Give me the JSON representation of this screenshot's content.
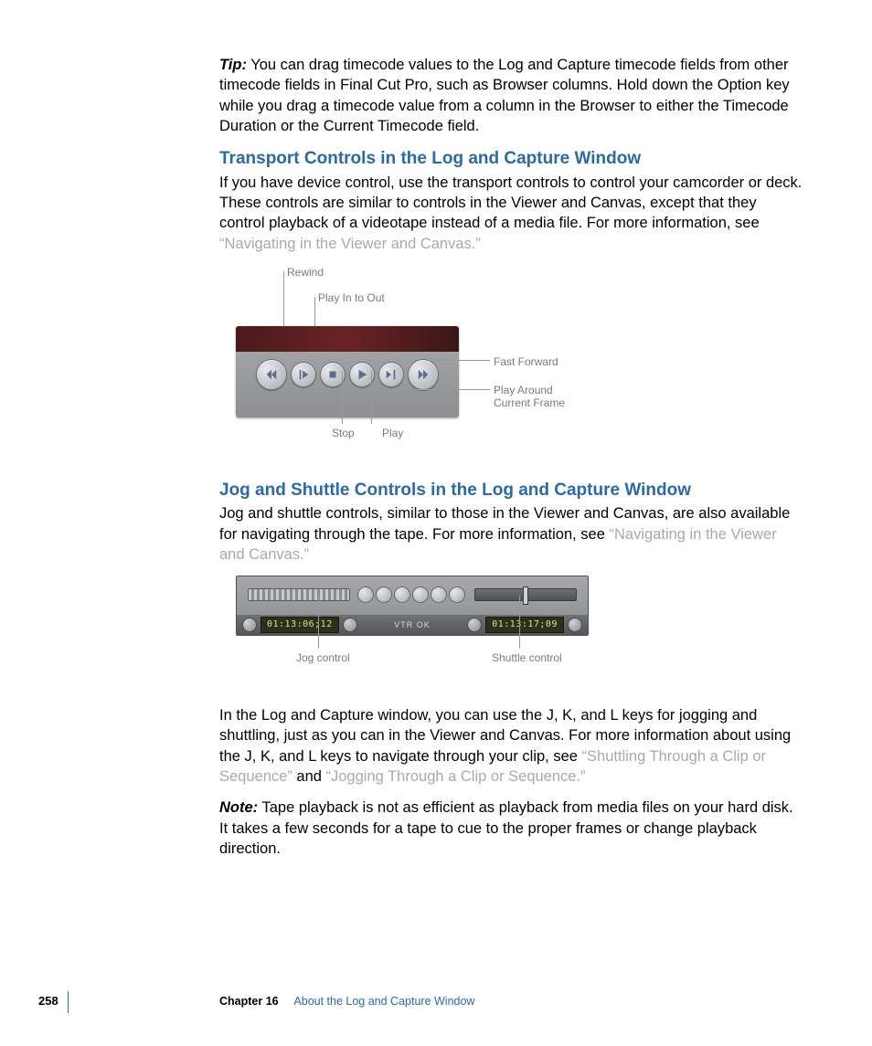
{
  "tip": {
    "label": "Tip:",
    "text": "You can drag timecode values to the Log and Capture timecode fields from other timecode fields in Final Cut Pro, such as Browser columns. Hold down the Option key while you drag a timecode value from a column in the Browser to either the Timecode Duration or the Current Timecode field."
  },
  "section1": {
    "heading": "Transport Controls in the Log and Capture Window",
    "body": "If you have device control, use the transport controls to control your camcorder or deck. These controls are similar to controls in the Viewer and Canvas, except that they control playback of a videotape instead of a media file. For more information, see ",
    "link": "“Navigating in the Viewer and Canvas.”"
  },
  "fig1_labels": {
    "rewind": "Rewind",
    "playInOut": "Play In to Out",
    "stop": "Stop",
    "play": "Play",
    "fastForward": "Fast Forward",
    "playAround1": "Play Around",
    "playAround2": "Current Frame"
  },
  "section2": {
    "heading": "Jog and Shuttle Controls in the Log and Capture Window",
    "body": "Jog and shuttle controls, similar to those in the Viewer and Canvas, are also available for navigating through the tape. For more information, see ",
    "link": "“Navigating in the Viewer and Canvas.”"
  },
  "fig2_labels": {
    "jog": "Jog control",
    "shuttle": "Shuttle control"
  },
  "panel": {
    "tc_left": "01:13:06;12",
    "vtr": "VTR OK",
    "tc_right": "01:13:17;09"
  },
  "para3": {
    "before": "In the Log and Capture window, you can use the J, K, and L keys for jogging and shuttling, just as you can in the Viewer and Canvas. For more information about using the J, K, and L keys to navigate through your clip, see ",
    "link1": "“Shuttling Through a Clip or Sequence”",
    "mid": " and ",
    "link2": "“Jogging Through a Clip or Sequence.”"
  },
  "note": {
    "label": "Note:",
    "text": "Tape playback is not as efficient as playback from media files on your hard disk. It takes a few seconds for a tape to cue to the proper frames or change playback direction."
  },
  "footer": {
    "page": "258",
    "chapter": "Chapter 16",
    "title": "About the Log and Capture Window"
  }
}
